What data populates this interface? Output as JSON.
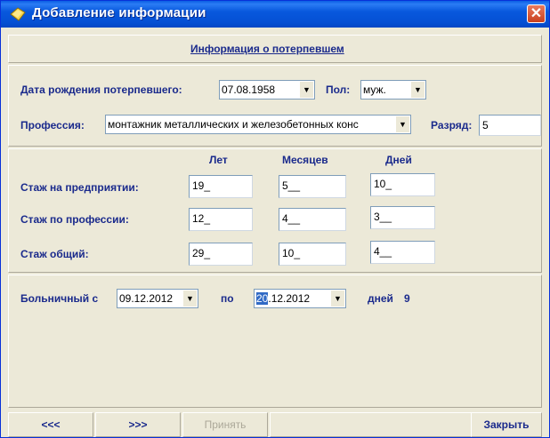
{
  "window": {
    "title": "Добавление информации",
    "close": "✕"
  },
  "section_title": "Информация о потерпевшем",
  "birth": {
    "label": "Дата рождения потерпевшего:",
    "value": "07.08.1958"
  },
  "gender": {
    "label": "Пол:",
    "value": "муж."
  },
  "profession": {
    "label": "Профессия:",
    "value": "монтажник металлических и железобетонных конс"
  },
  "grade": {
    "label": "Разряд:",
    "value": "5"
  },
  "columns": [
    "Лет",
    "Месяцев",
    "Дней"
  ],
  "rows": [
    {
      "label": "Стаж на предприятии:",
      "years": "19_",
      "months": "5__",
      "days": "10_"
    },
    {
      "label": "Стаж по профессии:",
      "years": "12_",
      "months": "4__",
      "days": "3__"
    },
    {
      "label": "Стаж общий:",
      "years": "29_",
      "months": "10_",
      "days": "4__"
    }
  ],
  "sick": {
    "label": "Больничный с",
    "from": "09.12.2012",
    "to_label": "по",
    "to_selected": "20",
    "to_rest": ".12.2012",
    "days_label": "дней",
    "days_value": "9"
  },
  "buttons": {
    "prev": "<<<",
    "next": ">>>",
    "accept": "Принять",
    "close": "Закрыть"
  },
  "icons": {
    "app": "dialog-icon",
    "dropdown": "chevron-down-icon"
  }
}
